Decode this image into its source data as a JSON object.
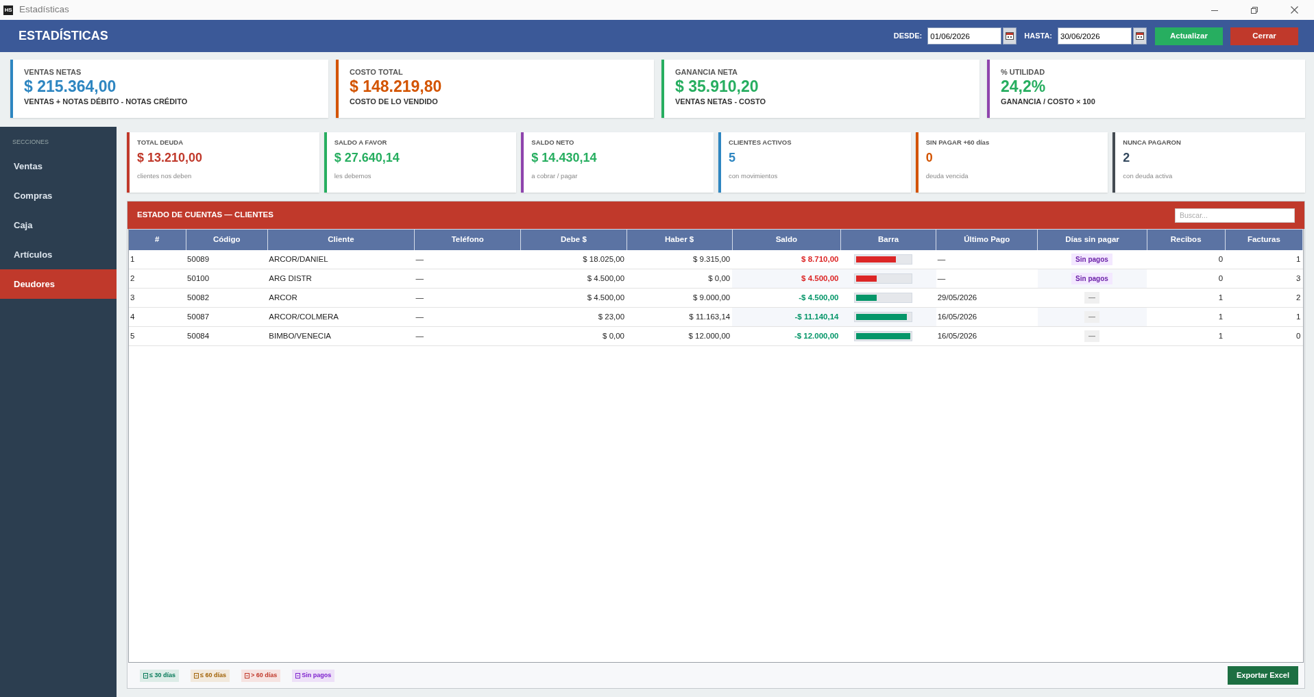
{
  "window": {
    "logo": "HS",
    "title": "Estadísticas"
  },
  "header": {
    "title": "ESTADÍSTICAS",
    "date_fields": [
      {
        "label": "DESDE:",
        "value": "01/06/2026"
      },
      {
        "label": "HASTA:",
        "value": "30/06/2026"
      }
    ],
    "buttons": [
      {
        "label": "Actualizar",
        "kind": "primary"
      },
      {
        "label": "Cerrar",
        "kind": "danger"
      }
    ]
  },
  "summary_cards": [
    {
      "label": "VENTAS NETAS",
      "value": {
        "text": "$ 215.364,00",
        "color": "#2e86c1"
      },
      "subtitle": "VENTAS + NOTAS DÉBITO - NOTAS CRÉDITO",
      "color": "#2e86c1"
    },
    {
      "label": "COSTO TOTAL",
      "value": {
        "text": "$ 148.219,80",
        "color": "#d35400"
      },
      "subtitle": "COSTO DE LO VENDIDO",
      "color": "#d35400"
    },
    {
      "label": "GANANCIA NETA",
      "value": {
        "text": "$ 35.910,20",
        "color": "#27ae60"
      },
      "subtitle": "VENTAS NETAS - COSTO",
      "color": "#27ae60"
    },
    {
      "label": "% UTILIDAD",
      "value": {
        "text": "24,2%",
        "color": "#27ae60"
      },
      "subtitle": "GANANCIA / COSTO × 100",
      "color": "#8e44ad"
    }
  ],
  "sidebar": {
    "heading": "SECCIONES",
    "items": [
      {
        "label": "Ventas",
        "selected": false
      },
      {
        "label": "Compras",
        "selected": false
      },
      {
        "label": "Caja",
        "selected": false
      },
      {
        "label": "Artículos",
        "selected": false
      },
      {
        "label": "Deudores",
        "selected": true
      }
    ]
  },
  "account_cards": [
    {
      "label": "TOTAL DEUDA",
      "value": {
        "text": "$ 13.210,00",
        "color": "#c0392b"
      },
      "subtitle": "clientes nos deben",
      "color": "#c0392b"
    },
    {
      "label": "SALDO A FAVOR",
      "value": {
        "text": "$ 27.640,14",
        "color": "#27ae60"
      },
      "subtitle": "les debemos",
      "color": "#27ae60"
    },
    {
      "label": "SALDO NETO",
      "value": {
        "text": "$ 14.430,14",
        "color": "#27ae60"
      },
      "subtitle": "a cobrar / pagar",
      "color": "#8e44ad"
    },
    {
      "label": "CLIENTES ACTIVOS",
      "value": {
        "text": "5",
        "color": "#2e86c1"
      },
      "subtitle": "con movimientos",
      "color": "#2e86c1"
    },
    {
      "label": "SIN PAGAR +60 días",
      "value": {
        "text": "0",
        "color": "#d35400"
      },
      "subtitle": "deuda vencida",
      "color": "#d35400"
    },
    {
      "label": "NUNCA PAGARON",
      "value": {
        "text": "2",
        "color": "#34495e"
      },
      "subtitle": "con deuda activa",
      "color": "#444b52"
    }
  ],
  "accounts_panel": {
    "title": "ESTADO DE CUENTAS — CLIENTES",
    "search": {
      "placeholder": "Buscar..."
    },
    "table": {
      "columns": [
        "#",
        "Código",
        "Cliente",
        "Teléfono",
        "Debe $",
        "Haber $",
        "Saldo",
        "Barra",
        "Último Pago",
        "Días sin pagar",
        "Recibos",
        "Facturas"
      ],
      "rows": [
        {
          "number": "1",
          "code": "50089",
          "client": "ARCOR/DANIEL",
          "phone": "—",
          "debit": "$ 18.025,00",
          "credit": "$ 9.315,00",
          "balance": "$ 8.710,00",
          "kind": "debt",
          "level": 0.73,
          "last_payment": "—",
          "days_unpaid": {
            "text": "Sin pagos",
            "kind": "never"
          },
          "receipts": "0",
          "invoices": "1"
        },
        {
          "number": "2",
          "code": "50100",
          "client": "ARG DISTR",
          "phone": "—",
          "debit": "$ 4.500,00",
          "credit": "$ 0,00",
          "balance": "$ 4.500,00",
          "kind": "debt",
          "level": 0.38,
          "last_payment": "—",
          "days_unpaid": {
            "text": "Sin pagos",
            "kind": "never"
          },
          "receipts": "0",
          "invoices": "3"
        },
        {
          "number": "3",
          "code": "50082",
          "client": "ARCOR",
          "phone": "—",
          "debit": "$ 4.500,00",
          "credit": "$ 9.000,00",
          "balance": "-$ 4.500,00",
          "kind": "credit",
          "level": 0.38,
          "last_payment": "29/05/2026",
          "days_unpaid": {
            "text": "—",
            "kind": "none"
          },
          "receipts": "1",
          "invoices": "2"
        },
        {
          "number": "4",
          "code": "50087",
          "client": "ARCOR/COLMERA",
          "phone": "—",
          "debit": "$ 23,00",
          "credit": "$ 11.163,14",
          "balance": "-$ 11.140,14",
          "kind": "credit",
          "level": 0.93,
          "last_payment": "16/05/2026",
          "days_unpaid": {
            "text": "—",
            "kind": "none"
          },
          "receipts": "1",
          "invoices": "1"
        },
        {
          "number": "5",
          "code": "50084",
          "client": "BIMBO/VENECIA",
          "phone": "—",
          "debit": "$ 0,00",
          "credit": "$ 12.000,00",
          "balance": "-$ 12.000,00",
          "kind": "credit",
          "level": 1.0,
          "last_payment": "16/05/2026",
          "days_unpaid": {
            "text": "—",
            "kind": "none"
          },
          "receipts": "1",
          "invoices": "0"
        }
      ]
    },
    "legend": [
      {
        "label": "≤ 30 días",
        "color": "#047857"
      },
      {
        "label": "≤ 60 días",
        "color": "#a16207"
      },
      {
        "label": "> 60 días",
        "color": "#c0392b"
      },
      {
        "label": "Sin pagos",
        "color": "#7e22ce"
      }
    ],
    "export_button": "Exportar Excel"
  }
}
